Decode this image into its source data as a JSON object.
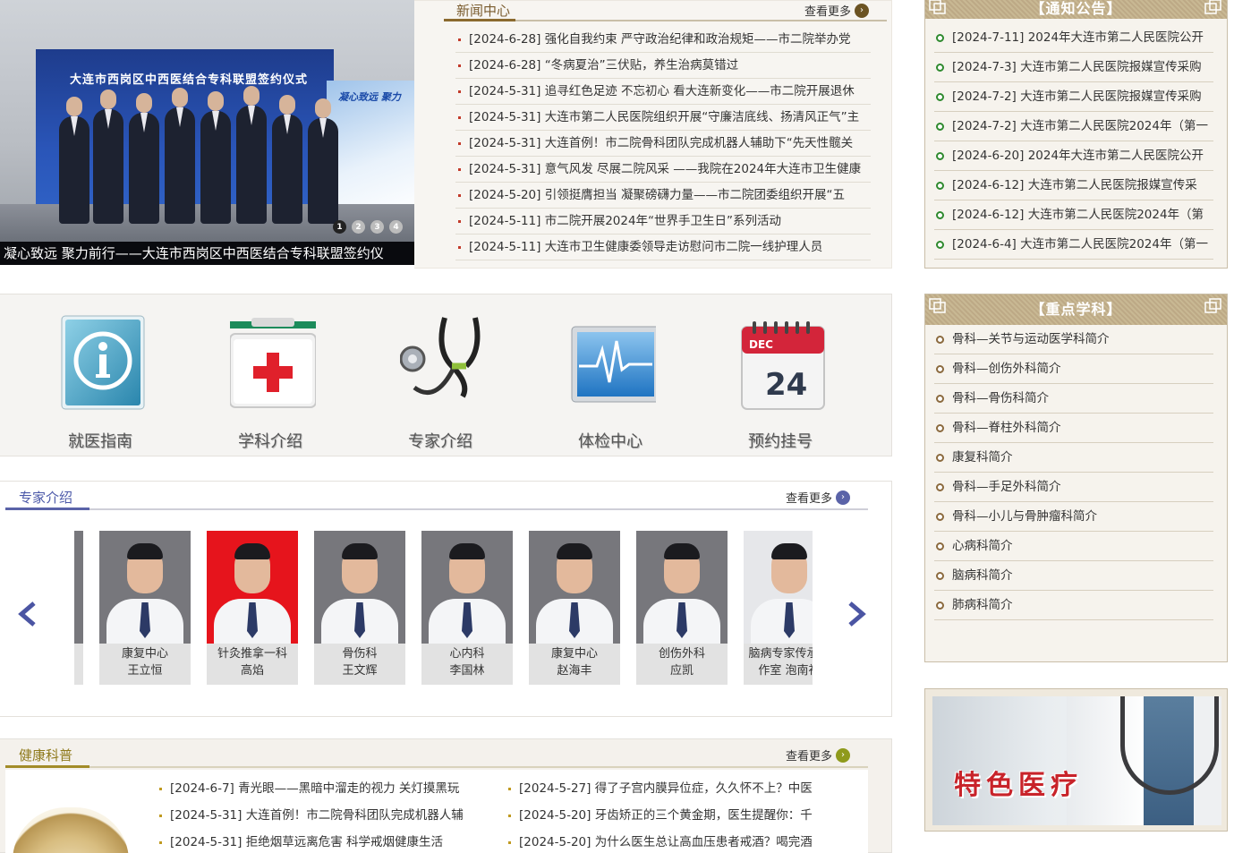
{
  "hero": {
    "caption": "凝心致远 聚力前行——大连市西岗区中西医结合专科联盟签约仪",
    "wall_title": "大连市西岗区中西医结合专科联盟签约仪式",
    "wall_side": "凝心致远 聚力",
    "dots": [
      "1",
      "2",
      "3",
      "4"
    ],
    "active_dot": 1
  },
  "news": {
    "title": "新闻中心",
    "more": "查看更多",
    "items": [
      "[2024-6-28] 强化自我约束 严守政治纪律和政治规矩——市二院举办党",
      "[2024-6-28] “冬病夏治”三伏贴，养生治病莫错过",
      "[2024-5-31] 追寻红色足迹 不忘初心 看大连新变化——市二院开展退休",
      "[2024-5-31] 大连市第二人民医院组织开展“守廉洁底线、扬清风正气”主",
      "[2024-5-31] 大连首例！市二院骨科团队完成机器人辅助下“先天性髋关",
      "[2024-5-31] 意气风发 尽展二院风采 ——我院在2024年大连市卫生健康",
      "[2024-5-20] 引领挺膺担当 凝聚磅礴力量——市二院团委组织开展“五",
      "[2024-5-11] 市二院开展2024年“世界手卫生日”系列活动",
      "[2024-5-11] 大连市卫生健康委领导走访慰问市二院一线护理人员"
    ]
  },
  "quick": {
    "items": [
      {
        "label": "就医指南",
        "icon": "info-icon"
      },
      {
        "label": "学科介绍",
        "icon": "first-aid-kit-icon"
      },
      {
        "label": "专家介绍",
        "icon": "stethoscope-icon"
      },
      {
        "label": "体检中心",
        "icon": "heartbeat-monitor-icon"
      },
      {
        "label": "预约挂号",
        "icon": "calendar-icon",
        "cal_month": "DEC",
        "cal_day": "24"
      }
    ]
  },
  "experts": {
    "title": "专家介绍",
    "more": "查看更多",
    "doctors": [
      {
        "dept": "康复中心",
        "name": "王立恒"
      },
      {
        "dept": "针灸推拿一科",
        "name": "高焰"
      },
      {
        "dept": "骨伤科",
        "name": "王文辉"
      },
      {
        "dept": "心内科",
        "name": "李国林"
      },
      {
        "dept": "康复中心",
        "name": "赵海丰"
      },
      {
        "dept": "创伤外科",
        "name": "应凯"
      },
      {
        "dept": "脑病专家传承工",
        "name": "作室 泡南社"
      }
    ]
  },
  "health": {
    "title": "健康科普",
    "more": "查看更多",
    "left_items": [
      "[2024-6-7] 青光眼——黑暗中溜走的视力 关灯摸黑玩",
      "[2024-5-31] 大连首例！市二院骨科团队完成机器人辅",
      "[2024-5-31] 拒绝烟草远离危害 科学戒烟健康生活"
    ],
    "right_items": [
      "[2024-5-27] 得了子宫内膜异位症，久久怀不上？中医",
      "[2024-5-20] 牙齿矫正的三个黄金期，医生提醒你：千",
      "[2024-5-20] 为什么医生总让高血压患者戒酒？喝完酒"
    ]
  },
  "notice": {
    "title": "【通知公告】",
    "items": [
      "[2024-7-11] 2024年大连市第二人民医院公开",
      "[2024-7-3] 大连市第二人民医院报媒宣传采购",
      "[2024-7-2] 大连市第二人民医院报媒宣传采购",
      "[2024-7-2] 大连市第二人民医院2024年（第一",
      "[2024-6-20] 2024年大连市第二人民医院公开",
      "[2024-6-12] 大连市第二人民医院报媒宣传采",
      "[2024-6-12] 大连市第二人民医院2024年（第",
      "[2024-6-4] 大连市第二人民医院2024年（第一"
    ]
  },
  "subjects": {
    "title": "【重点学科】",
    "items": [
      "骨科—关节与运动医学科简介",
      "骨科—创伤外科简介",
      "骨科—骨伤科简介",
      "骨科—脊柱外科简介",
      "康复科简介",
      "骨科—手足外科简介",
      "骨科—小儿与骨肿瘤科简介",
      "心病科简介",
      "脑病科简介",
      "肺病科简介"
    ]
  },
  "feature": {
    "text": "特色医疗"
  },
  "colors": {
    "news_accent": "#8b6a2e",
    "experts_accent": "#5a63a8",
    "health_accent": "#a28c28",
    "notice_bullet": "#2f8a2f",
    "feature_text": "#c8232a"
  }
}
